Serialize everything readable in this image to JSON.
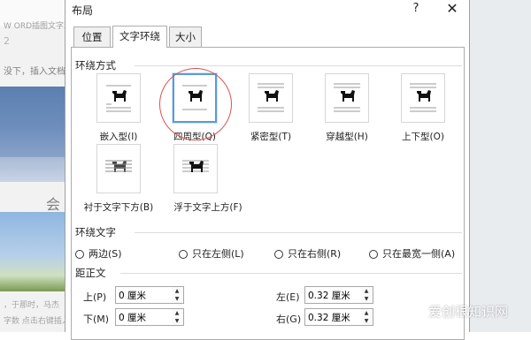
{
  "background_doc": {
    "text_line1": "W ORD插图文字环绕",
    "text_line2": "2",
    "text_line3": "没下，插入文档",
    "text_line4": "会",
    "text_line5": "，于那时，马杰",
    "text_line6": "字数 点击右键插入"
  },
  "dialog": {
    "title": "布局",
    "help": "?",
    "close": "✕"
  },
  "tabs": [
    {
      "label": "位置"
    },
    {
      "label": "文字环绕"
    },
    {
      "label": "大小"
    }
  ],
  "wrap_style": {
    "label": "环绕方式",
    "options": [
      {
        "label": "嵌入型(I)",
        "icon": "inline-wrap-icon"
      },
      {
        "label": "四周型(Q)",
        "icon": "square-wrap-icon",
        "selected": true
      },
      {
        "label": "紧密型(T)",
        "icon": "tight-wrap-icon"
      },
      {
        "label": "穿越型(H)",
        "icon": "through-wrap-icon"
      },
      {
        "label": "上下型(O)",
        "icon": "top-bottom-wrap-icon"
      },
      {
        "label": "衬于文字下方(B)",
        "icon": "behind-text-icon"
      },
      {
        "label": "浮于文字上方(F)",
        "icon": "in-front-of-text-icon"
      }
    ]
  },
  "wrap_text": {
    "label": "环绕文字",
    "options": [
      "两边(S)",
      "只在左侧(L)",
      "只在右侧(R)",
      "只在最宽一侧(A)"
    ]
  },
  "distance": {
    "label": "距正文",
    "top": {
      "label": "上(P)",
      "value": "0 厘米"
    },
    "bottom": {
      "label": "下(M)",
      "value": "0 厘米"
    },
    "left": {
      "label": "左(E)",
      "value": "0.32 厘米"
    },
    "right": {
      "label": "右(G)",
      "value": "0.32 厘米"
    }
  },
  "watermark": "爱创根知识网",
  "colors": {
    "selected_border": "#5b9bd5",
    "annotation_circle": "#d9534f"
  }
}
